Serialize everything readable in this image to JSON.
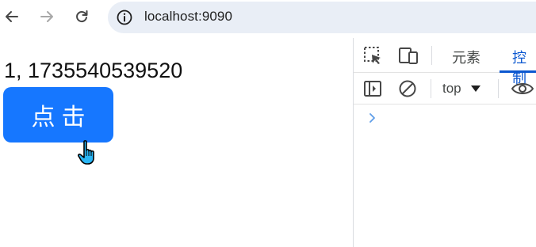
{
  "browser": {
    "url": "localhost:9090",
    "icons": {
      "back": "arrow-left-icon",
      "forward": "arrow-right-icon",
      "reload": "reload-icon",
      "site_info": "info-icon"
    }
  },
  "page": {
    "output_text": "1, 1735540539520",
    "button_label": "点击",
    "button_color": "#1677ff"
  },
  "devtools": {
    "tabs": [
      {
        "label": "元素",
        "active": false
      },
      {
        "label": "控制",
        "active": true
      }
    ],
    "context": "top",
    "accent_color": "#0b57d0"
  }
}
